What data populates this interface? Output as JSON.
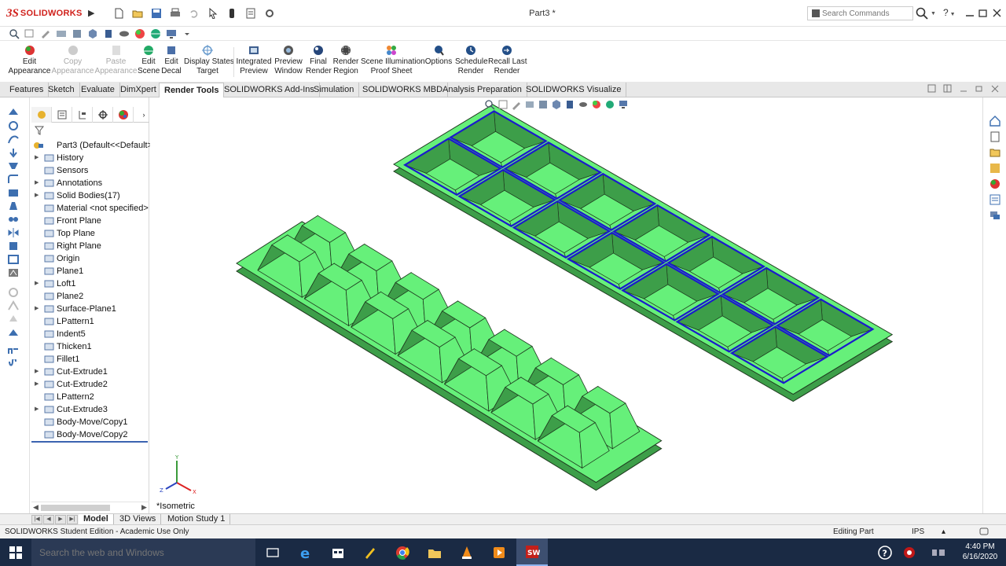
{
  "app": {
    "logo_ds": "3S",
    "logo_text": "SOLIDWORKS",
    "document_title": "Part3 *",
    "search_placeholder": "Search Commands",
    "help_label": "?"
  },
  "command_manager": {
    "items": [
      {
        "line1": "Edit",
        "line2": "Appearance",
        "enabled": true
      },
      {
        "line1": "Copy",
        "line2": "Appearance",
        "enabled": false
      },
      {
        "line1": "Paste",
        "line2": "Appearance",
        "enabled": false
      },
      {
        "line1": "Edit",
        "line2": "Scene",
        "enabled": true
      },
      {
        "line1": "Edit",
        "line2": "Decal",
        "enabled": true
      },
      {
        "line1": "Display States",
        "line2": "Target",
        "enabled": true
      },
      {
        "line1": "Integrated",
        "line2": "Preview",
        "enabled": true
      },
      {
        "line1": "Preview",
        "line2": "Window",
        "enabled": true
      },
      {
        "line1": "Final",
        "line2": "Render",
        "enabled": true
      },
      {
        "line1": "Render",
        "line2": "Region",
        "enabled": true
      },
      {
        "line1": "Scene Illumination",
        "line2": "Proof Sheet",
        "enabled": true
      },
      {
        "line1": "Options",
        "line2": "",
        "enabled": true
      },
      {
        "line1": "Schedule",
        "line2": "Render",
        "enabled": true
      },
      {
        "line1": "Recall Last",
        "line2": "Render",
        "enabled": true
      }
    ]
  },
  "tabs": [
    "Features",
    "Sketch",
    "Evaluate",
    "DimXpert",
    "Render Tools",
    "SOLIDWORKS Add-Ins",
    "Simulation",
    "SOLIDWORKS MBD",
    "Analysis Preparation",
    "SOLIDWORKS Visualize"
  ],
  "active_tab": "Render Tools",
  "feature_tree": {
    "root": "Part3  (Default<<Default>",
    "nodes": [
      {
        "label": "History",
        "expandable": true
      },
      {
        "label": "Sensors",
        "expandable": false
      },
      {
        "label": "Annotations",
        "expandable": true
      },
      {
        "label": "Solid Bodies(17)",
        "expandable": true
      },
      {
        "label": "Material <not specified>",
        "expandable": false
      },
      {
        "label": "Front Plane",
        "expandable": false
      },
      {
        "label": "Top Plane",
        "expandable": false
      },
      {
        "label": "Right Plane",
        "expandable": false
      },
      {
        "label": "Origin",
        "expandable": false
      },
      {
        "label": "Plane1",
        "expandable": false
      },
      {
        "label": "Loft1",
        "expandable": true
      },
      {
        "label": "Plane2",
        "expandable": false
      },
      {
        "label": "Surface-Plane1",
        "expandable": true
      },
      {
        "label": "LPattern1",
        "expandable": false
      },
      {
        "label": "Indent5",
        "expandable": false
      },
      {
        "label": "Thicken1",
        "expandable": false
      },
      {
        "label": "Fillet1",
        "expandable": false
      },
      {
        "label": "Cut-Extrude1",
        "expandable": true
      },
      {
        "label": "Cut-Extrude2",
        "expandable": true
      },
      {
        "label": "LPattern2",
        "expandable": false
      },
      {
        "label": "Cut-Extrude3",
        "expandable": true
      },
      {
        "label": "Body-Move/Copy1",
        "expandable": false
      },
      {
        "label": "Body-Move/Copy2",
        "expandable": false
      }
    ]
  },
  "viewport": {
    "view_name": "*Isometric",
    "part_color": "#66f07a",
    "part_shade": "#3d9e49",
    "edge_color": "#1f3a1f",
    "highlight_color": "#1a1acc"
  },
  "model_tabs": [
    "Model",
    "3D Views",
    "Motion Study 1"
  ],
  "active_model_tab": "Model",
  "status": {
    "text": "SOLIDWORKS Student Edition - Academic Use Only",
    "editing": "Editing Part",
    "units": "IPS"
  },
  "taskbar": {
    "search_placeholder": "Search the web and Windows",
    "time": "4:40 PM",
    "date": "6/16/2020"
  }
}
